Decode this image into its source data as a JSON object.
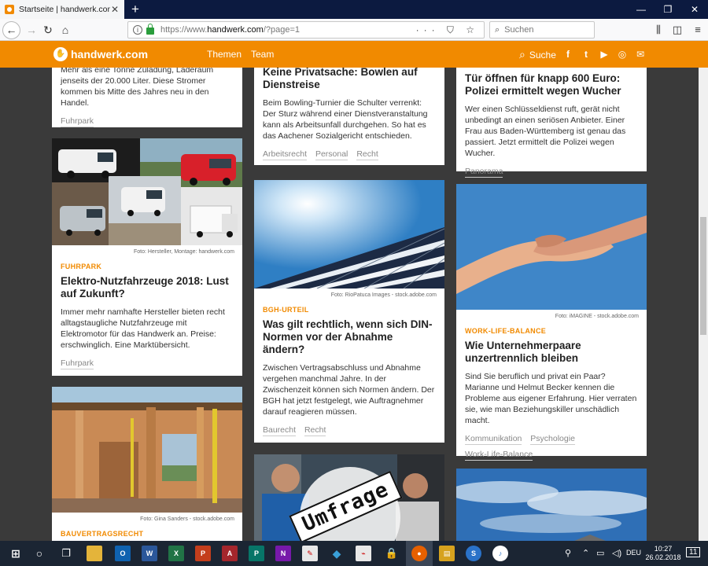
{
  "browser": {
    "tab_title": "Startseite | handwerk.com – die",
    "tab_close": "✕",
    "new_tab": "+",
    "url_prefix": "https://www.",
    "url_host": "handwerk.com",
    "url_path": "/?page=1",
    "search_placeholder": "Suchen",
    "url_icons": "··· ⛉ ☆"
  },
  "site": {
    "logo": "handwerk.com",
    "nav": [
      "Themen",
      "Team"
    ],
    "search_label": "Suche",
    "social": [
      "f",
      "t",
      "▶",
      "◎",
      "✉"
    ],
    "accent_color": "#f18a00"
  },
  "cards": {
    "c1": {
      "teaser": "Mehr als eine Tonne Zuladung, Laderaum jenseits der 20.000 Liter. Diese Stromer kommen bis Mitte des Jahres neu in den Handel.",
      "tags": [
        "Fuhrpark"
      ]
    },
    "c2": {
      "credit": "Foto: Hersteller, Montage: handwerk.com",
      "kicker": "Fuhrpark",
      "headline": "Elektro-Nutzfahrzeuge 2018: Lust auf Zukunft?",
      "teaser": "Immer mehr namhafte Hersteller bieten recht alltagstaugliche Nutzfahrzeuge mit Elektromotor für das Handwerk an. Preise: erschwinglich. Eine Marktübersicht.",
      "tags": [
        "Fuhrpark"
      ]
    },
    "c3": {
      "credit": "Foto: Gina Sanders - stock.adobe.com",
      "kicker": "Bauvertragsrecht"
    },
    "m1": {
      "headline": "Keine Privatsache: Bowlen auf Dienstreise",
      "teaser": "Beim Bowling-Turnier die Schulter verrenkt: Der Sturz während einer Dienstveranstaltung kann als Arbeitsunfall durchgehen. So hat es das Aachener Sozialgericht entschieden.",
      "tags": [
        "Arbeitsrecht",
        "Personal",
        "Recht"
      ]
    },
    "m2": {
      "credit": "Foto: RioPatuca Images - stock.adobe.com",
      "kicker": "BGH-Urteil",
      "headline": "Was gilt rechtlich, wenn sich DIN-Normen vor der Abnahme ändern?",
      "teaser": "Zwischen Vertragsabschluss und Abnahme vergehen manchmal Jahre. In der Zwischenzeit können sich Normen ändern. Der BGH hat jetzt festgelegt, wie Auftragnehmer darauf reagieren müssen.",
      "tags": [
        "Baurecht",
        "Recht"
      ]
    },
    "m3": {
      "overlay": "Umfrage"
    },
    "r1": {
      "headline": "Tür öffnen für knapp 600 Euro: Polizei ermittelt wegen Wucher",
      "teaser": "Wer einen Schlüsseldienst ruft, gerät nicht unbedingt an einen seriösen Anbieter. Einer Frau aus Baden-Württemberg ist genau das passiert. Jetzt ermittelt die Polizei wegen Wucher.",
      "tags": [
        "Panorama"
      ]
    },
    "r2": {
      "credit": "Foto: iMAGINE - stock.adobe.com",
      "kicker": "Work-Life-Balance",
      "headline": "Wie Unternehmerpaare unzertrennlich bleiben",
      "teaser": "Sind Sie beruflich und privat ein Paar? Marianne und Helmut Becker kennen die Probleme aus eigener Erfahrung. Hier verraten sie, wie man Beziehungskiller unschädlich macht.",
      "tags": [
        "Kommunikation",
        "Psychologie",
        "Work-Life-Balance"
      ]
    }
  },
  "taskbar": {
    "lang": "DEU",
    "time": "10:27",
    "date": "26.02.2018",
    "notification_count": "11"
  }
}
